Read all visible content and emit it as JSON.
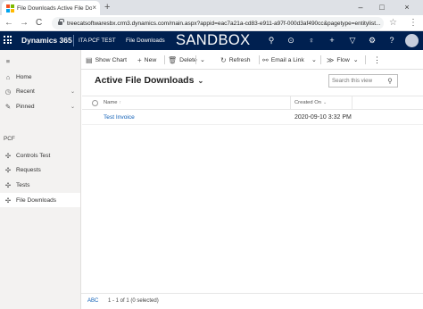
{
  "browser": {
    "tab_title": "File Downloads Active File Dow",
    "tab_close": "×",
    "new_tab": "+",
    "minimize": "–",
    "maximize": "□",
    "close": "×",
    "url": "treecatsoftwaresbx.crm3.dynamics.com/main.aspx?appid=eac7a21a-cd83-e911-a97f-000d3af490cc&pagetype=entitylist...",
    "back": "←",
    "forward": "→",
    "reload": "C",
    "star": "☆",
    "menu": "⋮"
  },
  "header": {
    "brand": "Dynamics 365",
    "app_name": "ITA PCF TEST",
    "breadcrumb": "File Downloads",
    "environment_banner": "SANDBOX",
    "icons": [
      {
        "name": "search-icon",
        "glyph": "⚲"
      },
      {
        "name": "task-icon",
        "glyph": "⊙"
      },
      {
        "name": "lightbulb-icon",
        "glyph": "♀"
      },
      {
        "name": "plus-icon",
        "glyph": "+"
      },
      {
        "name": "filter-icon",
        "glyph": "▽"
      },
      {
        "name": "settings-icon",
        "glyph": "⚙"
      },
      {
        "name": "help-icon",
        "glyph": "?"
      }
    ],
    "avatar_initials": ""
  },
  "command_bar": {
    "show_chart": "Show Chart",
    "new": "New",
    "delete": "Delete",
    "refresh": "Refresh",
    "email_link": "Email a Link",
    "flow": "Flow",
    "more": "⋮",
    "chevron": "⌄"
  },
  "sidebar": {
    "menu_glyph": "≡",
    "items": [
      {
        "label": "Home",
        "icon": "home-icon",
        "glyph": "⌂"
      },
      {
        "label": "Recent",
        "icon": "clock-icon",
        "glyph": "◷",
        "chevron": "⌄"
      },
      {
        "label": "Pinned",
        "icon": "pin-icon",
        "glyph": "✎",
        "chevron": "⌄"
      }
    ],
    "group_label": "PCF",
    "group_items": [
      {
        "label": "Controls Test",
        "icon": "puzzle-icon",
        "glyph": "✣"
      },
      {
        "label": "Requests",
        "icon": "puzzle-icon",
        "glyph": "✣"
      },
      {
        "label": "Tests",
        "icon": "puzzle-icon",
        "glyph": "✣"
      },
      {
        "label": "File Downloads",
        "icon": "puzzle-icon",
        "glyph": "✣"
      }
    ]
  },
  "main": {
    "view_title": "Active File Downloads",
    "view_chevron": "⌄",
    "search_placeholder": "Search this view",
    "columns": [
      {
        "label": "Name",
        "sort": "↑"
      },
      {
        "label": "Created On",
        "sort": "⌄"
      }
    ],
    "rows": [
      {
        "name": "Test Invoice",
        "created_on": "2020-09-10 3:32 PM"
      }
    ]
  },
  "footer": {
    "abc": "ABC",
    "count": "1 - 1 of 1 (0 selected)"
  },
  "colors": {
    "header_bg": "#002050",
    "link": "#1160b7",
    "nav_bg": "#f3f2f1",
    "tabstrip_bg": "#dee1e6"
  }
}
